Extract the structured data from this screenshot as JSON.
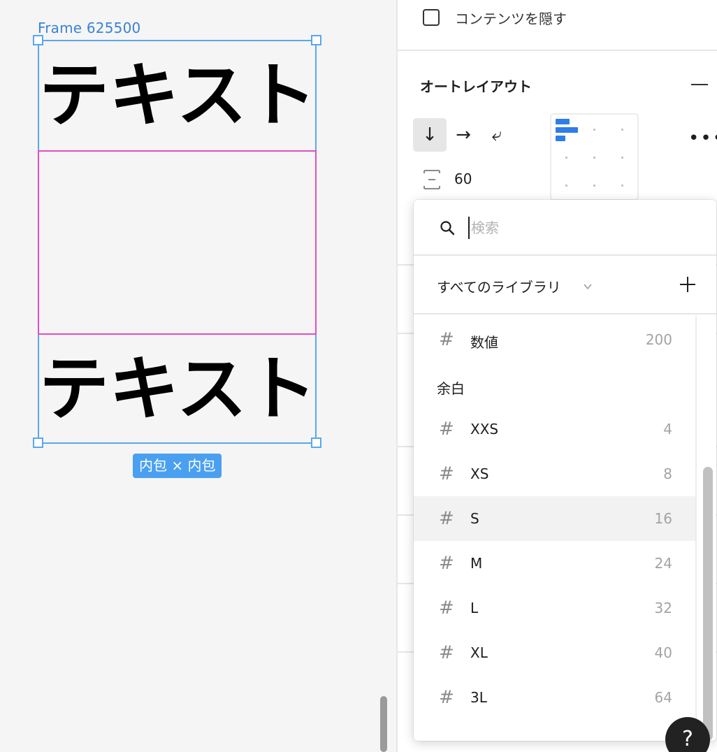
{
  "canvas": {
    "frame_label": "Frame 625500",
    "text_top": "テキスト",
    "text_bottom": "テキスト",
    "size_badge": "内包 × 内包"
  },
  "panel": {
    "hide_content_label": "コンテンツを隠す",
    "hide_content_checked": false,
    "auto_layout_title": "オートレイアウト",
    "direction_buttons": [
      "↓",
      "→",
      "⤶"
    ],
    "direction_active": "↓",
    "more_label": "•••",
    "gap_value": "60",
    "accent_color": "#2e7de8"
  },
  "dropdown": {
    "search_placeholder": "検索",
    "library_label": "すべてのライブラリ",
    "items": [
      {
        "type": "variable",
        "icon": "#",
        "name": "数値",
        "value": "200"
      },
      {
        "type": "group",
        "name": "余白"
      },
      {
        "type": "variable",
        "icon": "#",
        "name": "XXS",
        "value": "4"
      },
      {
        "type": "variable",
        "icon": "#",
        "name": "XS",
        "value": "8"
      },
      {
        "type": "variable",
        "icon": "#",
        "name": "S",
        "value": "16",
        "highlighted": true
      },
      {
        "type": "variable",
        "icon": "#",
        "name": "M",
        "value": "24"
      },
      {
        "type": "variable",
        "icon": "#",
        "name": "L",
        "value": "32"
      },
      {
        "type": "variable",
        "icon": "#",
        "name": "XL",
        "value": "40"
      },
      {
        "type": "variable",
        "icon": "#",
        "name": "3L",
        "value": "64"
      }
    ]
  },
  "help_label": "?"
}
